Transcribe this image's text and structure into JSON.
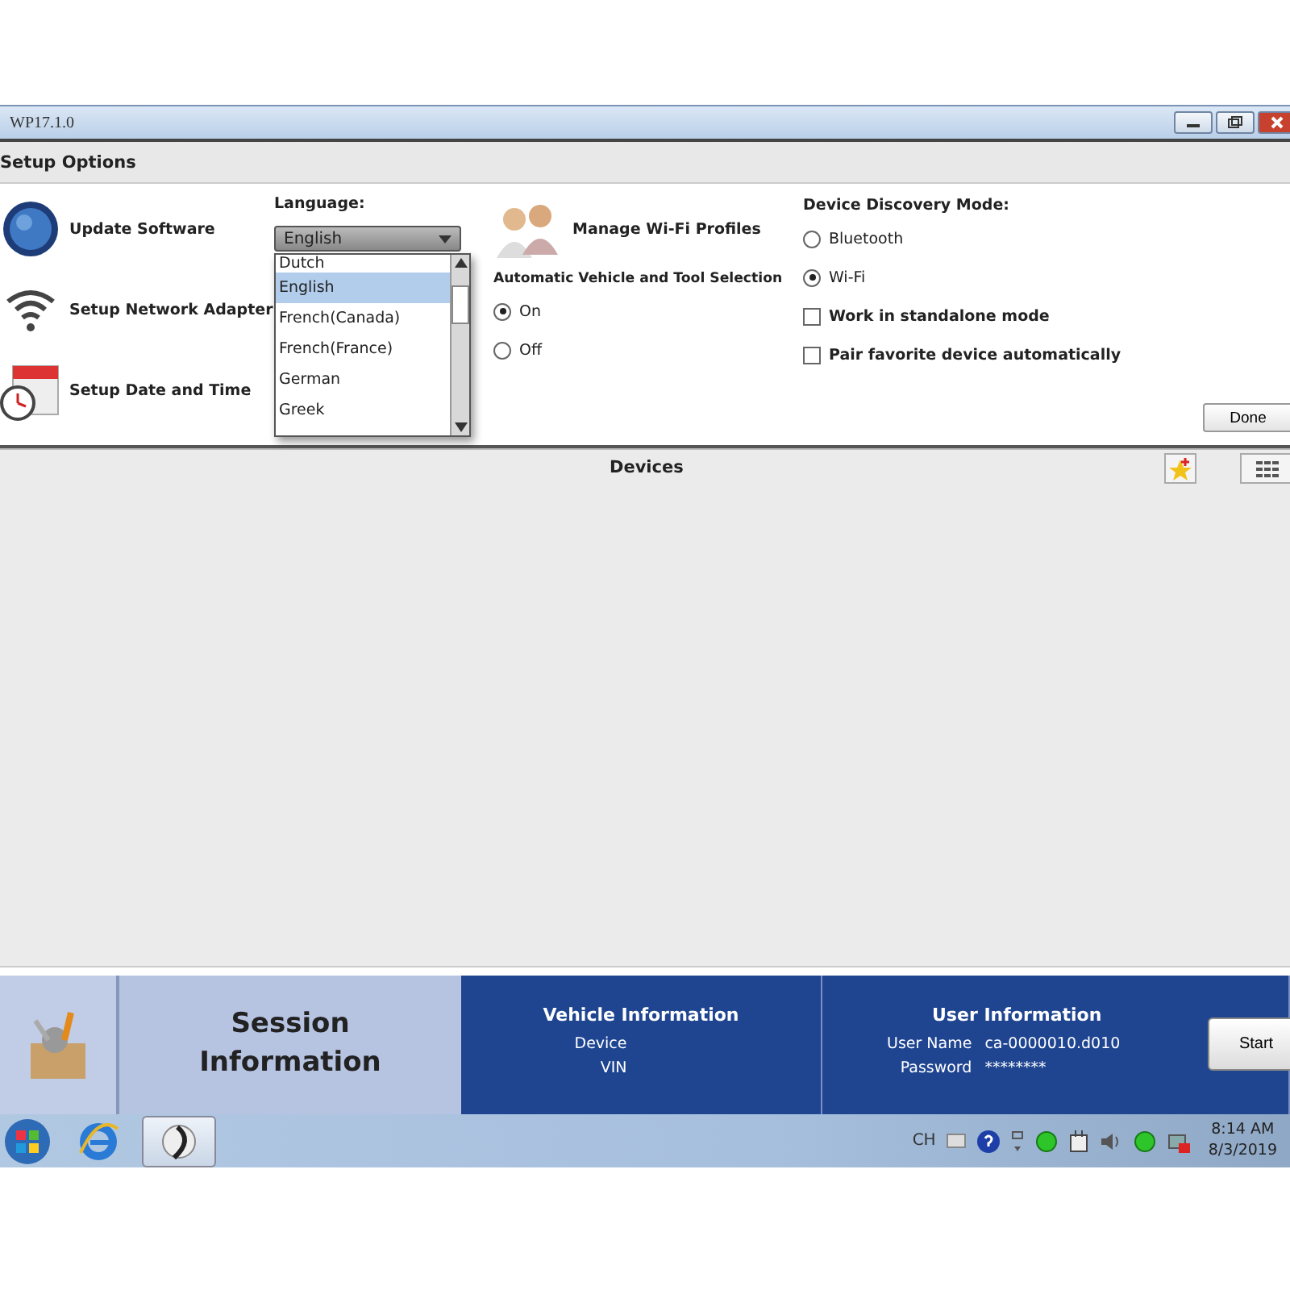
{
  "window": {
    "title": "WP17.1.0"
  },
  "setup_options": {
    "title": "Setup Options",
    "actions": [
      {
        "kind": "globe",
        "label": "Update Software"
      },
      {
        "kind": "wifi",
        "label": "Setup Network Adapter"
      },
      {
        "kind": "calendar",
        "label": "Setup Date and Time"
      }
    ],
    "language": {
      "label": "Language:",
      "value": "English",
      "options": [
        {
          "label": "Dutch",
          "selected": false
        },
        {
          "label": "English",
          "selected": true
        },
        {
          "label": "French(Canada)",
          "selected": false
        },
        {
          "label": "French(France)",
          "selected": false
        },
        {
          "label": "German",
          "selected": false
        },
        {
          "label": "Greek",
          "selected": false
        }
      ]
    },
    "wifi_profiles": "Manage Wi-Fi Profiles",
    "auto_selection": {
      "label": "Automatic Vehicle and Tool Selection",
      "options": [
        {
          "label": "On",
          "selected": true
        },
        {
          "label": "Off",
          "selected": false
        }
      ]
    },
    "discovery": {
      "label": "Device Discovery Mode:",
      "options": [
        {
          "label": "Bluetooth",
          "selected": false
        },
        {
          "label": "Wi-Fi",
          "selected": true
        }
      ]
    },
    "checkboxes": [
      {
        "label": "Work in standalone mode",
        "checked": false
      },
      {
        "label": "Pair favorite device automatically",
        "checked": false
      }
    ],
    "done_button": "Done"
  },
  "devices": {
    "title": "Devices"
  },
  "session": {
    "title": "Session Information",
    "vehicle": {
      "title": "Vehicle Information",
      "fields": [
        "Device",
        "VIN"
      ]
    },
    "user": {
      "title": "User Information",
      "fields": [
        {
          "label": "User Name",
          "value": "ca-0000010.d010"
        },
        {
          "label": "Password",
          "value": "********"
        }
      ]
    },
    "start_button": "Start"
  },
  "taskbar": {
    "language": "CH",
    "time": "8:14 AM",
    "date": "8/3/2019"
  }
}
